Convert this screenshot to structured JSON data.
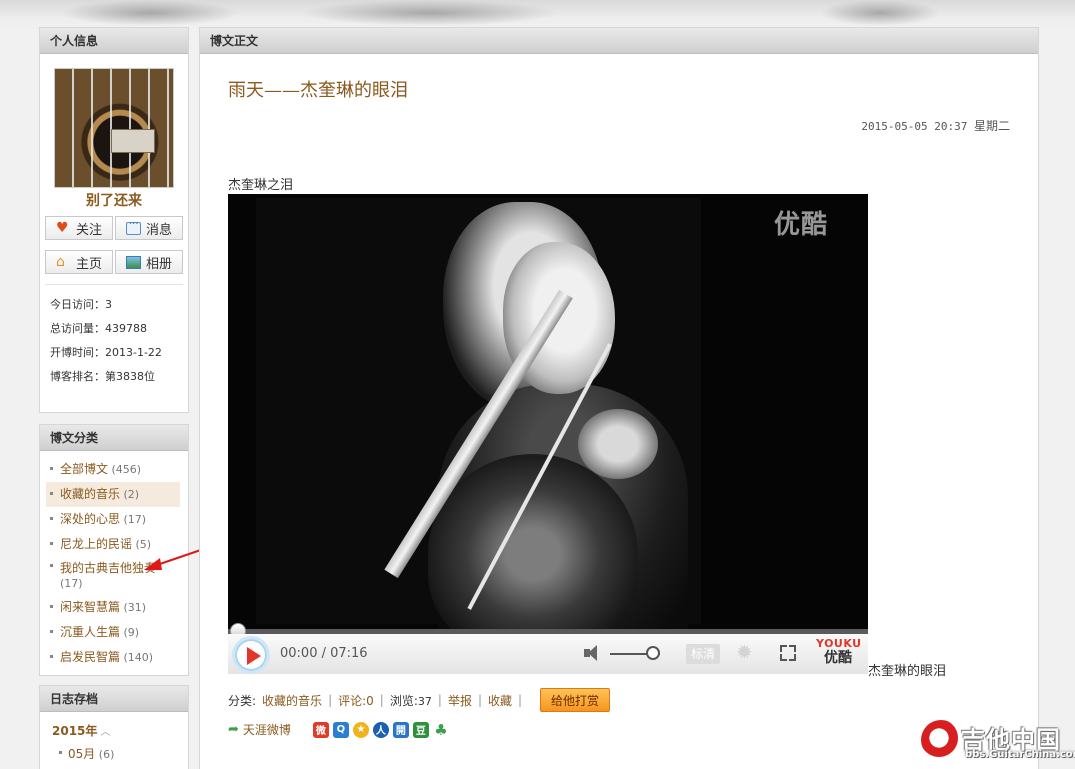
{
  "sidebar": {
    "profile": {
      "title": "个人信息",
      "username": "别了还来",
      "buttons": {
        "follow": "关注",
        "message": "消息",
        "home": "主页",
        "album": "相册"
      },
      "stats": [
        {
          "label": "今日访问",
          "value": "3"
        },
        {
          "label": "总访问量",
          "value": "439788"
        },
        {
          "label": "开博时间",
          "value": "2013-1-22"
        },
        {
          "label": "博客排名",
          "value": "第3838位"
        }
      ]
    },
    "categories": {
      "title": "博文分类",
      "items": [
        {
          "label": "全部博文",
          "count": "(456)"
        },
        {
          "label": "收藏的音乐",
          "count": "(2)"
        },
        {
          "label": "深处的心思",
          "count": "(17)"
        },
        {
          "label": "尼龙上的民谣",
          "count": "(5)"
        },
        {
          "label": "我的古典吉他独奏",
          "count": "(17)"
        },
        {
          "label": "闲来智慧篇",
          "count": "(31)"
        },
        {
          "label": "沉重人生篇",
          "count": "(9)"
        },
        {
          "label": "启发民智篇",
          "count": "(140)"
        }
      ]
    },
    "archive": {
      "title": "日志存档",
      "year": "2015年",
      "month": "05月",
      "month_count": "(6)"
    }
  },
  "main": {
    "section_title": "博文正文",
    "post": {
      "title": "雨天——杰奎琳的眼泪",
      "date": "2015-05-05 20:37",
      "weekday": "星期二",
      "intro": "杰奎琳之泪",
      "after_video": "杰奎琳的眼泪"
    },
    "video": {
      "watermark": "优酷",
      "timecode": "00:00 / 07:16",
      "progress": 0,
      "volume": 0.85,
      "quality": "标清",
      "logo_en": "YOUKU",
      "logo_cn": "优酷"
    },
    "meta": {
      "category_label": "分类:",
      "category_value": "收藏的音乐",
      "comments": "评论:0",
      "views_label": "浏览:",
      "views_value": "37",
      "report": "举报",
      "favorite": "收藏",
      "reward": "给他打赏"
    },
    "share": {
      "weibo": "天涯微博"
    }
  },
  "watermark": {
    "cn": "吉他中国",
    "url": "bbs.GuitarChina.com"
  },
  "colors": {
    "accent": "#8a5a1e",
    "play": "#e2362b",
    "reward": "#f6951e"
  }
}
